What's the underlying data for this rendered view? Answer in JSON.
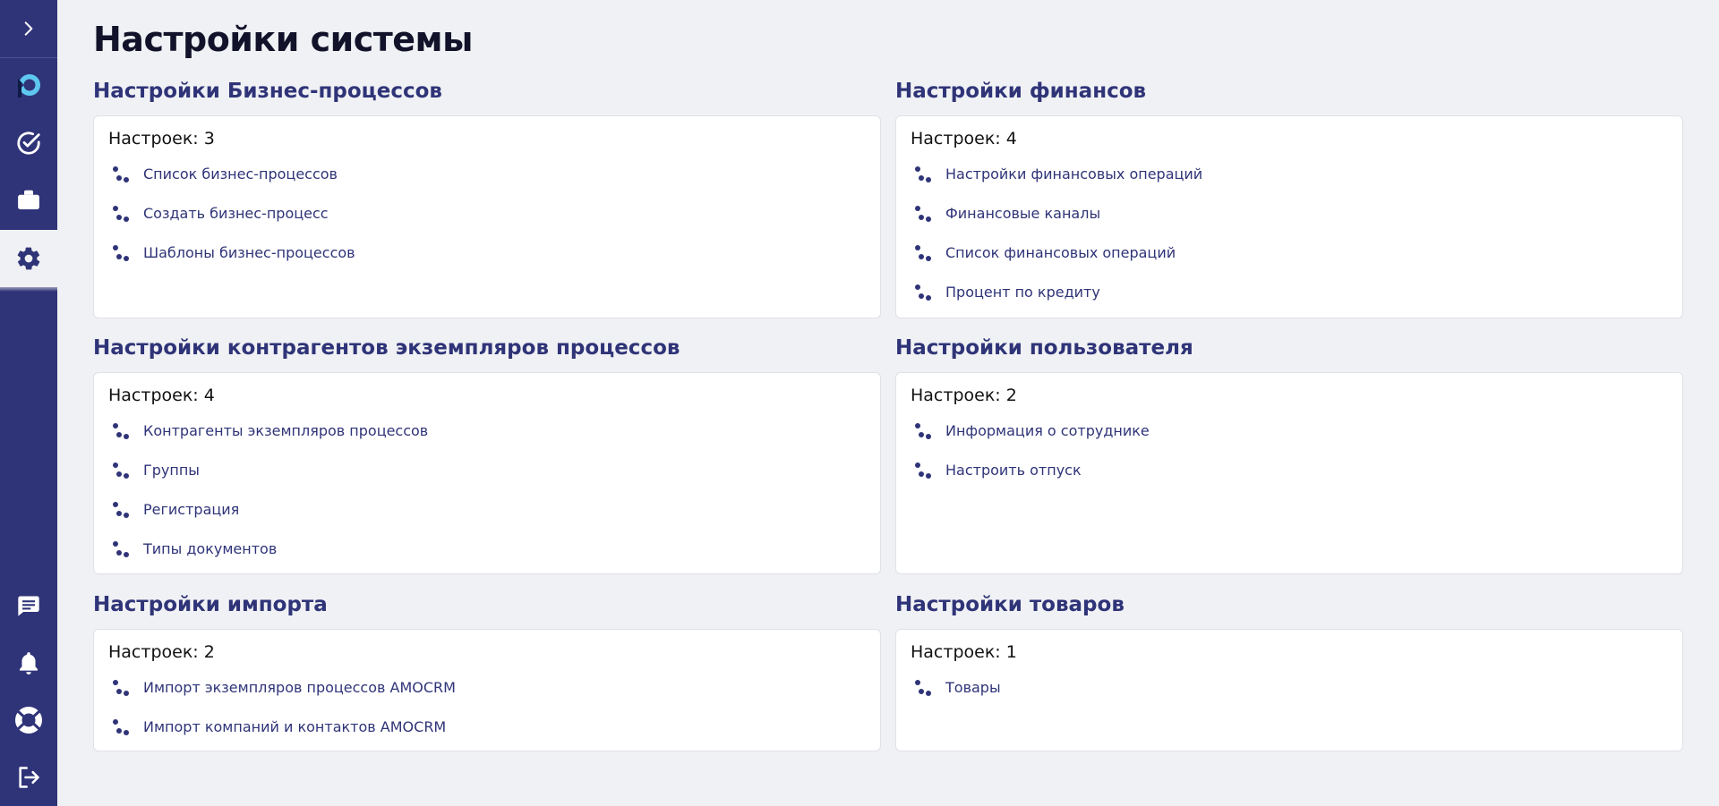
{
  "page": {
    "title": "Настройки системы"
  },
  "sidebar": {
    "top": [
      {
        "icon": "chevron-right-icon"
      },
      {
        "icon": "logo-icon"
      },
      {
        "icon": "check-circle-icon"
      },
      {
        "icon": "briefcase-icon"
      },
      {
        "icon": "gear-icon",
        "active": true
      }
    ],
    "bottom": [
      {
        "icon": "chat-icon"
      },
      {
        "icon": "bell-icon"
      },
      {
        "icon": "lifebuoy-icon"
      },
      {
        "icon": "logout-icon"
      }
    ]
  },
  "colors": {
    "sidebar": "#2f3478",
    "accent": "#2f3478",
    "background": "#f0f1f4",
    "card": "#ffffff"
  },
  "sections": [
    {
      "title": "Настройки Бизнес-процессов",
      "count_label": "Настроек:",
      "count": "3",
      "items": [
        "Список бизнес-процессов",
        "Создать бизнес-процесс",
        "Шаблоны бизнес-процессов"
      ]
    },
    {
      "title": "Настройки финансов",
      "count_label": "Настроек:",
      "count": "4",
      "items": [
        "Настройки финансовых операций",
        "Финансовые каналы",
        "Список финансовых операций",
        "Процент по кредиту"
      ]
    },
    {
      "title": "Настройки контрагентов экземпляров процессов",
      "count_label": "Настроек:",
      "count": "4",
      "items": [
        "Контрагенты экземпляров процессов",
        "Группы",
        "Регистрация",
        "Типы документов"
      ]
    },
    {
      "title": "Настройки пользователя",
      "count_label": "Настроек:",
      "count": "2",
      "items": [
        "Информация о сотруднике",
        "Настроить отпуск"
      ]
    },
    {
      "title": "Настройки импорта",
      "count_label": "Настроек:",
      "count": "2",
      "items": [
        "Импорт экземпляров процессов AMOCRM",
        "Импорт компаний и контактов AMOCRM"
      ]
    },
    {
      "title": "Настройки товаров",
      "count_label": "Настроек:",
      "count": "1",
      "items": [
        "Товары"
      ]
    }
  ]
}
